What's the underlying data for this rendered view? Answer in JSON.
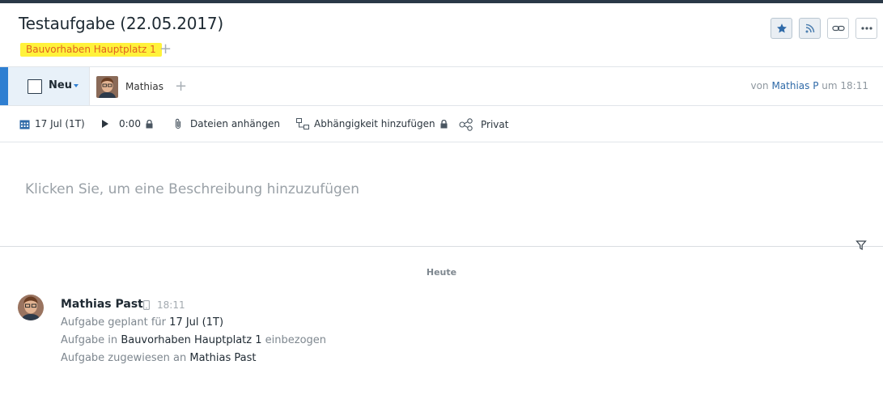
{
  "task": {
    "title": "Testaufgabe (22.05.2017)",
    "tag": "Bauvorhaben Hauptplatz 1",
    "tag_add": "+"
  },
  "header_buttons": {
    "star": "star-icon",
    "rss": "rss-icon",
    "link": "link-icon",
    "more": "more-icon"
  },
  "status": {
    "label": "Neu",
    "color": "#2f7fd1"
  },
  "assignee": {
    "name": "Mathias",
    "add": "+"
  },
  "meta": {
    "prefix": "von",
    "author": "Mathias P",
    "middle": "um",
    "time": "18:11"
  },
  "toolbar": {
    "date": "17 Jul (1T)",
    "time": "0:00",
    "attach": "Dateien anhängen",
    "dependency": "Abhängigkeit hinzufügen",
    "private": "Privat"
  },
  "description_placeholder": "Klicken Sie, um eine Beschreibung hinzuzufügen",
  "activity": {
    "day_label": "Heute",
    "author": "Mathias Past",
    "time": "18:11",
    "lines": [
      {
        "pre": "Aufgabe geplant für",
        "value": "17 Jul (1T)",
        "post": ""
      },
      {
        "pre": "Aufgabe in",
        "value": "Bauvorhaben Hauptplatz 1",
        "post": "einbezogen"
      },
      {
        "pre": "Aufgabe zugewiesen an",
        "value": "Mathias Past",
        "post": ""
      }
    ]
  }
}
